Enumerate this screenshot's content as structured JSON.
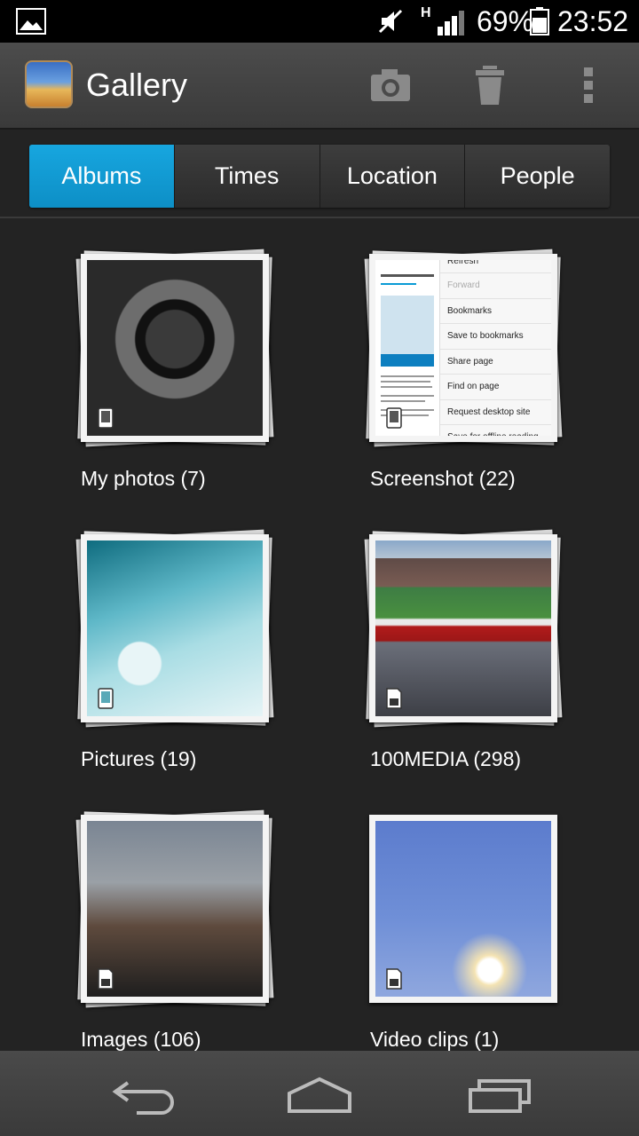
{
  "status_bar": {
    "network_type": "H",
    "battery_percent": "69%",
    "time": "23:52"
  },
  "action_bar": {
    "title": "Gallery",
    "icons": [
      "camera-icon",
      "trash-icon",
      "overflow-menu-icon"
    ]
  },
  "tabs": [
    {
      "label": "Albums",
      "active": true
    },
    {
      "label": "Times",
      "active": false
    },
    {
      "label": "Location",
      "active": false
    },
    {
      "label": "People",
      "active": false
    }
  ],
  "albums": [
    {
      "label": "My photos  (7)"
    },
    {
      "label": "Screenshot  (22)"
    },
    {
      "label": "Pictures  (19)"
    },
    {
      "label": "100MEDIA  (298)"
    },
    {
      "label": "Images  (106)"
    },
    {
      "label": "Video clips  (1)"
    }
  ],
  "screenshot_menu": [
    "Refresh",
    "Forward",
    "Bookmarks",
    "Save to bookmarks",
    "Share page",
    "Find on page",
    "Request desktop site",
    "Save for offline reading"
  ],
  "colors": {
    "accent": "#0d9fd8",
    "background": "#232323"
  }
}
